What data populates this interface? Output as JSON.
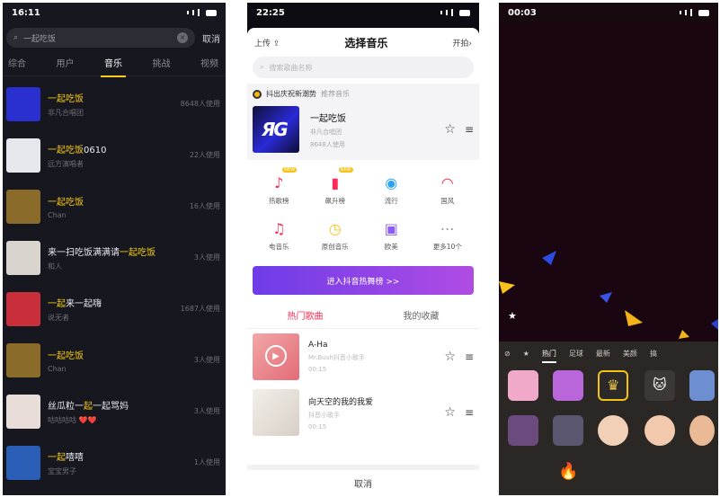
{
  "phone1": {
    "status_time": "16:11",
    "search_value": "一起吃饭",
    "cancel_label": "取消",
    "tabs": [
      "综合",
      "用户",
      "音乐",
      "挑战",
      "视频"
    ],
    "active_tab": "音乐",
    "results": [
      {
        "prefix": "",
        "highlight": "一起吃饭",
        "suffix": "",
        "artist": "非凡合唱团",
        "uses": "8648人使用",
        "cover_color": "#2a2fd0"
      },
      {
        "prefix": "",
        "highlight": "一起吃饭",
        "suffix": "0610",
        "artist": "远方演唱者",
        "uses": "22人使用",
        "cover_color": "#e6e8ee"
      },
      {
        "prefix": "",
        "highlight": "一起吃饭",
        "suffix": "",
        "artist": "Chan",
        "uses": "16人使用",
        "cover_color": "#8a6b2a"
      },
      {
        "prefix": "来一扫吃饭满满请",
        "highlight": "一起吃饭",
        "suffix": "",
        "artist": "和人",
        "uses": "3人使用",
        "cover_color": "#d9d4cd"
      },
      {
        "prefix": "",
        "highlight": "一起",
        "suffix": "来一起嗨",
        "artist": "说无者",
        "uses": "1687人使用",
        "cover_color": "#c92f3a"
      },
      {
        "prefix": "",
        "highlight": "一起吃饭",
        "suffix": "",
        "artist": "Chan",
        "uses": "3人使用",
        "cover_color": "#8a6b2a"
      },
      {
        "prefix": "丝瓜粒一",
        "highlight": "起",
        "suffix": "一起骂妈",
        "artist": "咕咕咕咕 ❤️❤️",
        "uses": "3人使用",
        "cover_color": "#e8ddd8"
      },
      {
        "prefix": "",
        "highlight": "一起",
        "suffix": "嘻嘻",
        "artist": "宝宝男子",
        "uses": "1人使用",
        "cover_color": "#2b5fb7"
      }
    ]
  },
  "phone2": {
    "status_time": "22:25",
    "upload_label": "上传",
    "title": "选择音乐",
    "start_label": "开拍",
    "search_placeholder": "搜索歌曲名称",
    "promo_title": "抖出庆祝新潮势",
    "promo_sub": "推荐音乐",
    "featured": {
      "name": "一起吃饭",
      "artist": "非凡合唱团",
      "uses": "8648人使用"
    },
    "grid": [
      {
        "label": "热歌榜",
        "icon": "tiktok-icon",
        "badge": "NEW",
        "color": "#fe2c55"
      },
      {
        "label": "飙升榜",
        "icon": "bar-chart-icon",
        "badge": "NEW",
        "color": "#fe2c55"
      },
      {
        "label": "流行",
        "icon": "disc-icon",
        "badge": "",
        "color": "#2aa4f4"
      },
      {
        "label": "国风",
        "icon": "fan-icon",
        "badge": "",
        "color": "#fe2c55"
      },
      {
        "label": "电音乐",
        "icon": "guitar-icon",
        "badge": "",
        "color": "#fe2c55"
      },
      {
        "label": "原创音乐",
        "icon": "clock-icon",
        "badge": "",
        "color": "#f7c21c"
      },
      {
        "label": "欧美",
        "icon": "bus-icon",
        "badge": "",
        "color": "#8b5cf6"
      },
      {
        "label": "更多10个",
        "icon": "more-icon",
        "badge": "",
        "color": "#999999"
      }
    ],
    "cta_label": "进入抖音热舞榜 >>",
    "tabs": [
      "热门歌曲",
      "我的收藏"
    ],
    "songs": [
      {
        "name": "A-Ha",
        "artist": "Mr.Bush抖音小歌手",
        "duration": "00:15"
      },
      {
        "name": "向天空的我的我爱",
        "artist": "抖音小歌手",
        "duration": "00:15"
      }
    ],
    "cancel_label": "取消"
  },
  "phone3": {
    "status_time": "00:03",
    "tabs": [
      "热门",
      "足球",
      "最新",
      "美颜",
      "搞"
    ],
    "active_tab": "热门"
  }
}
